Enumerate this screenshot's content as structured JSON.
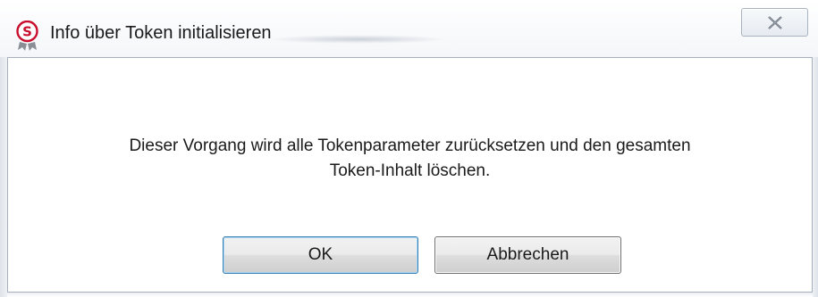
{
  "window": {
    "title": "Info über Token initialisieren",
    "icon": "app-s-logo-icon",
    "close_icon": "close-icon",
    "accent_color": "#c8102e"
  },
  "dialog": {
    "message_line1": "Dieser Vorgang wird alle Tokenparameter zurücksetzen und den gesamten",
    "message_line2": "Token-Inhalt löschen.",
    "ok_label": "OK",
    "cancel_label": "Abbrechen"
  }
}
